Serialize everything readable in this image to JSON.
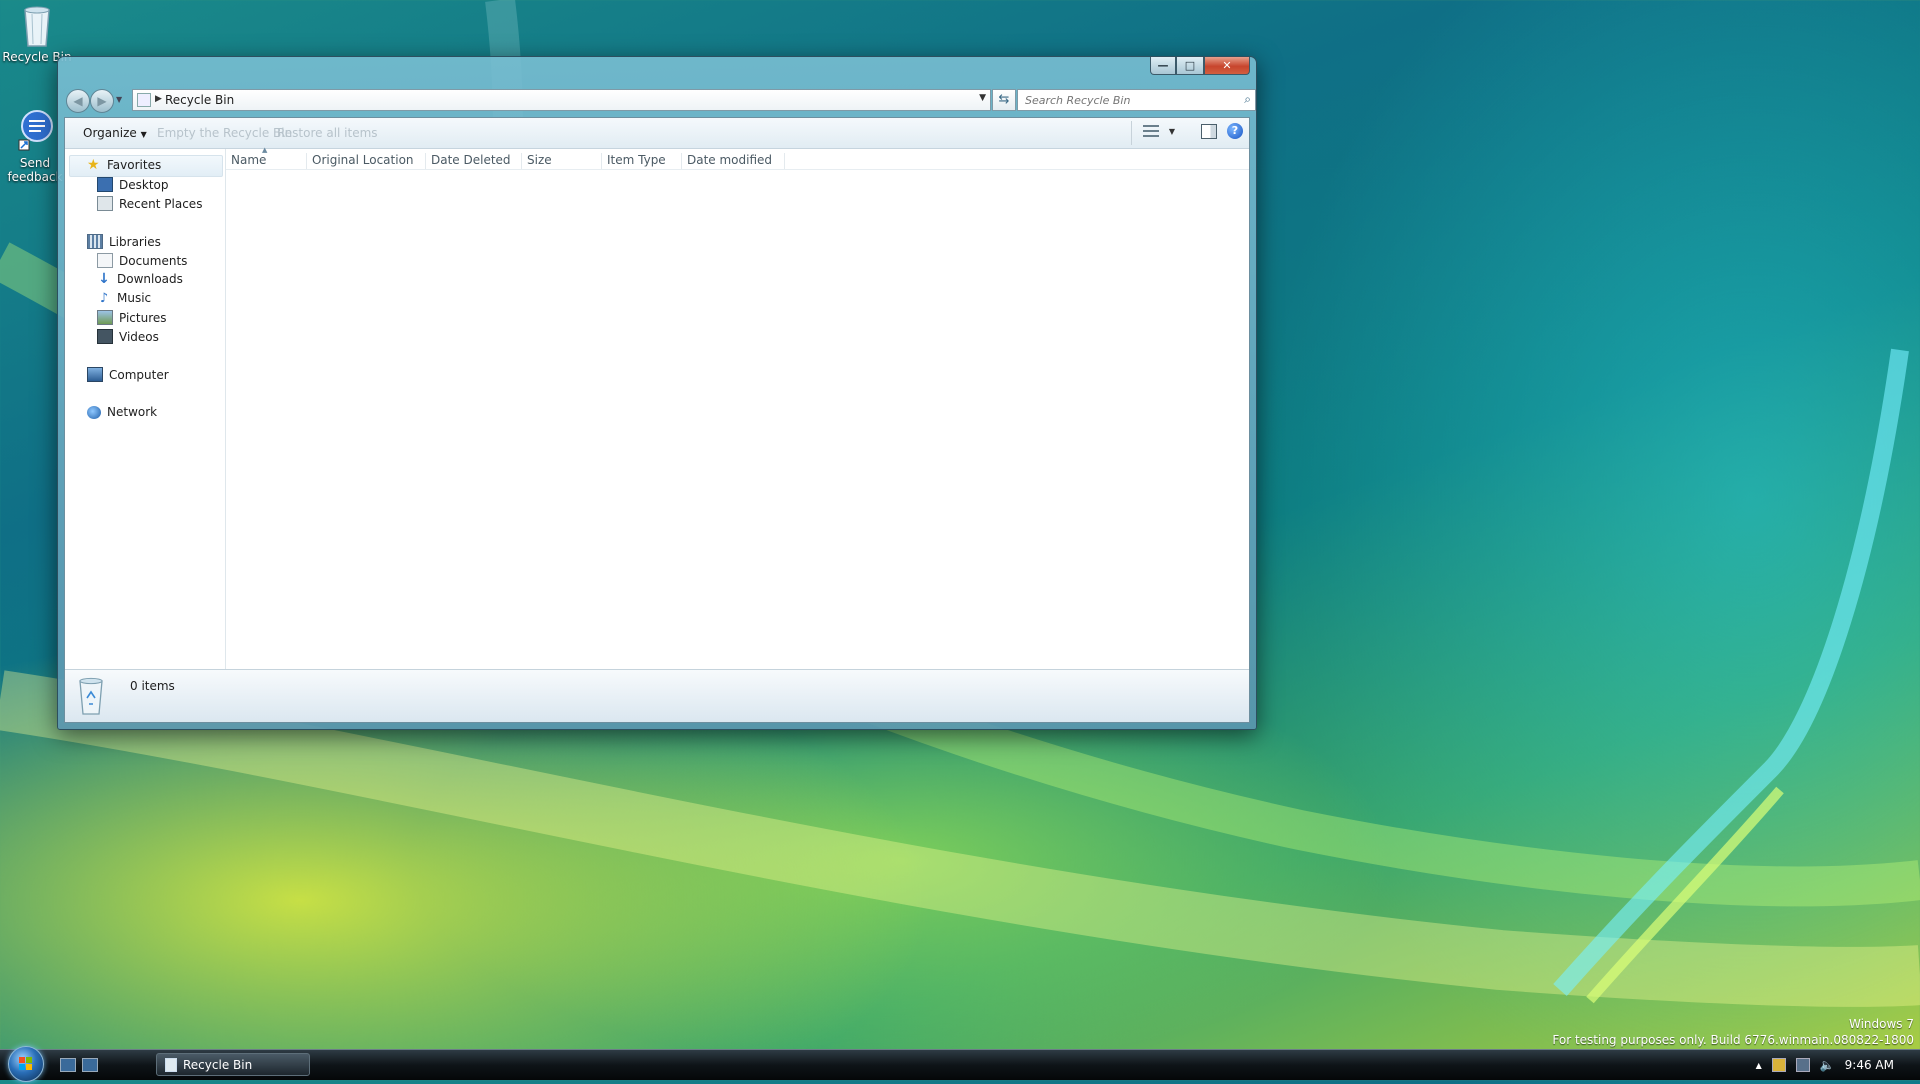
{
  "desktop": {
    "icons": [
      {
        "label": "Recycle Bin"
      },
      {
        "label": "Send feedback"
      }
    ]
  },
  "window": {
    "title": "Recycle Bin",
    "caption": {
      "minimize": "—",
      "maximize": "□",
      "close": "✕"
    },
    "nav": {
      "back": "◀",
      "forward": "▶"
    },
    "address": {
      "breadcrumb": "Recycle Bin"
    },
    "search": {
      "placeholder": "Search Recycle Bin"
    },
    "toolbar": {
      "organize": "Organize",
      "empty": "Empty the Recycle Bin",
      "restore": "Restore all items"
    },
    "navpane": {
      "favorites": "Favorites",
      "desktop": "Desktop",
      "recent": "Recent Places",
      "libraries": "Libraries",
      "documents": "Documents",
      "downloads": "Downloads",
      "music": "Music",
      "pictures": "Pictures",
      "videos": "Videos",
      "computer": "Computer",
      "network": "Network"
    },
    "columns": [
      "Name",
      "Original Location",
      "Date Deleted",
      "Size",
      "Item Type",
      "Date modified"
    ],
    "details": {
      "count": "0 items"
    }
  },
  "taskbar": {
    "task_label": "Recycle Bin",
    "clock": "9:46 AM"
  },
  "watermark": {
    "line1": "Windows 7",
    "line2": "For testing purposes only. Build 6776.winmain.080822-1800"
  },
  "colors": {
    "accent": "#1754c4",
    "close_button": "#c7452d"
  }
}
